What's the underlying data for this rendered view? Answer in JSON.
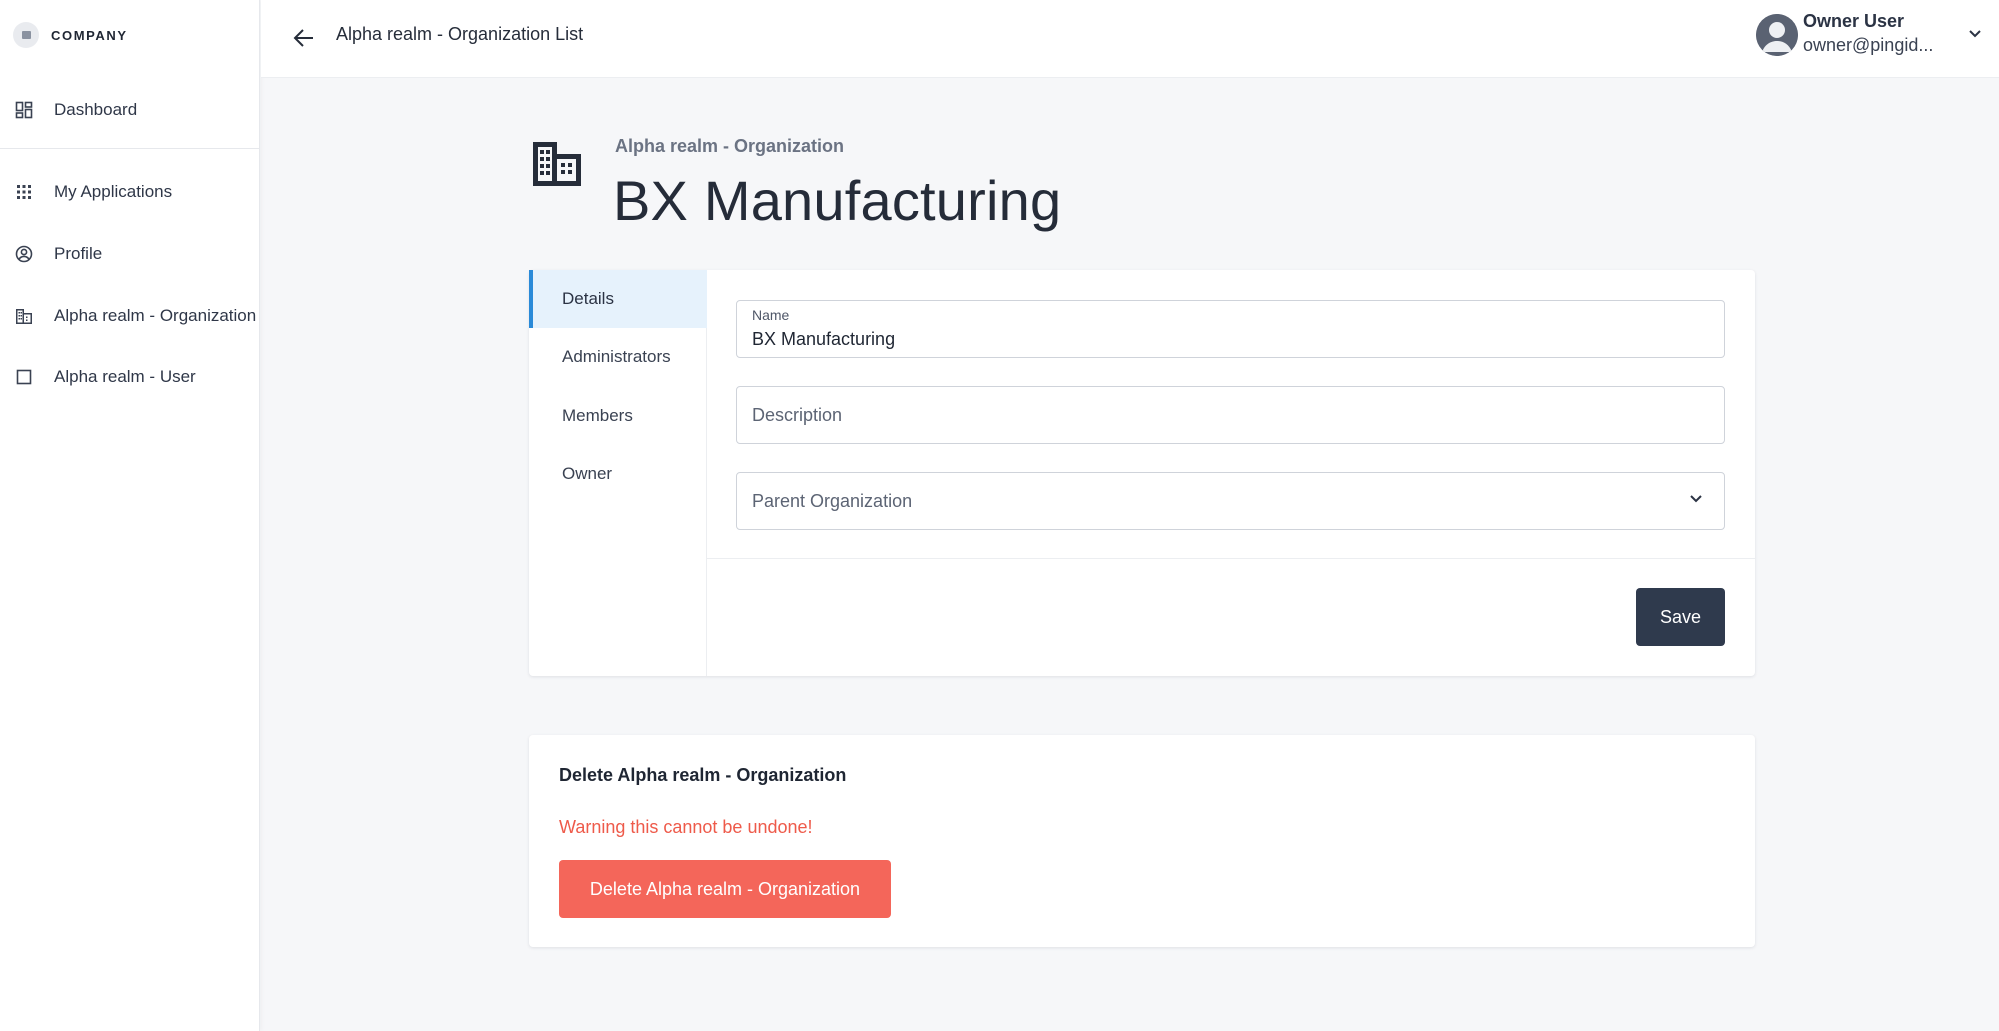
{
  "brand": {
    "name": "COMPANY",
    "logo_icon": "company-logo-icon"
  },
  "sidebar": {
    "items": [
      {
        "label": "Dashboard",
        "icon": "dashboard-icon"
      },
      {
        "label": "My Applications",
        "icon": "apps-grid-icon"
      },
      {
        "label": "Profile",
        "icon": "user-circle-icon"
      },
      {
        "label": "Alpha realm - Organization",
        "icon": "building-icon"
      },
      {
        "label": "Alpha realm - User",
        "icon": "square-icon"
      }
    ]
  },
  "topbar": {
    "back_icon": "arrow-left-icon",
    "title": "Alpha realm - Organization List"
  },
  "user": {
    "name": "Owner User",
    "email": "owner@pingid...",
    "avatar_icon": "avatar-icon",
    "chevron_icon": "chevron-down-icon"
  },
  "header": {
    "icon": "building-icon",
    "subtitle": "Alpha realm - Organization",
    "title": "BX Manufacturing"
  },
  "tabs": [
    {
      "label": "Details",
      "active": true
    },
    {
      "label": "Administrators",
      "active": false
    },
    {
      "label": "Members",
      "active": false
    },
    {
      "label": "Owner",
      "active": false
    }
  ],
  "form": {
    "name": {
      "label": "Name",
      "value": "BX Manufacturing"
    },
    "description": {
      "placeholder": "Description",
      "value": ""
    },
    "parent": {
      "placeholder": "Parent Organization",
      "value": ""
    },
    "save_label": "Save"
  },
  "delete": {
    "title": "Delete Alpha realm - Organization",
    "warning": "Warning this cannot be undone!",
    "button_label": "Delete Alpha realm - Organization"
  },
  "colors": {
    "accent": "#2a8ad8",
    "primary_button": "#2f3a4d",
    "danger": "#f4665a",
    "warning_text": "#ee5a4a"
  }
}
